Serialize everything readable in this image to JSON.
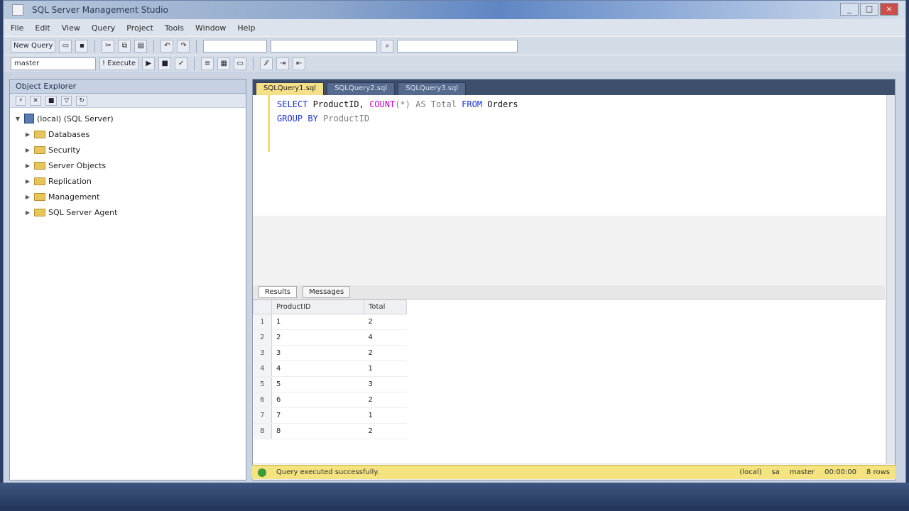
{
  "window": {
    "title": "SQL Server Management Studio",
    "controls": [
      "_",
      "□",
      "×"
    ]
  },
  "menu": [
    "File",
    "Edit",
    "View",
    "Query",
    "Project",
    "Tools",
    "Window",
    "Help"
  ],
  "toolbar": {
    "new_query_label": "New Query",
    "execute_label": "! Execute",
    "database_combo": "master"
  },
  "explorer": {
    "header": "Object Explorer",
    "nodes": [
      {
        "label": "(local) (SQL Server)",
        "level": 0,
        "icon": "server-icon"
      },
      {
        "label": "Databases",
        "level": 1,
        "icon": "folder-icon"
      },
      {
        "label": "Security",
        "level": 1,
        "icon": "folder-icon"
      },
      {
        "label": "Server Objects",
        "level": 1,
        "icon": "folder-icon"
      },
      {
        "label": "Replication",
        "level": 1,
        "icon": "folder-icon"
      },
      {
        "label": "Management",
        "level": 1,
        "icon": "folder-icon"
      },
      {
        "label": "SQL Server Agent",
        "level": 1,
        "icon": "folder-icon"
      }
    ]
  },
  "editor": {
    "tabs": [
      "SQLQuery1.sql",
      "SQLQuery2.sql",
      "SQLQuery3.sql"
    ],
    "code": {
      "line1": {
        "kw": "SELECT",
        "a": "ProductID,",
        "fn": "COUNT",
        "b": "(*) AS Total",
        "c": "FROM",
        "d": "Orders"
      },
      "line2": {
        "kw": "GROUP BY",
        "a": "ProductID"
      }
    }
  },
  "results": {
    "tabs": [
      "Results",
      "Messages"
    ],
    "columns": [
      "ProductID",
      "Total"
    ],
    "rows": [
      [
        "1",
        "2"
      ],
      [
        "2",
        "4"
      ],
      [
        "3",
        "2"
      ],
      [
        "4",
        "1"
      ],
      [
        "5",
        "3"
      ],
      [
        "6",
        "2"
      ],
      [
        "7",
        "1"
      ],
      [
        "8",
        "2"
      ]
    ]
  },
  "status": {
    "message": "Query executed successfully.",
    "server": "(local)",
    "user": "sa",
    "database": "master",
    "time": "00:00:00",
    "rows": "8 rows"
  }
}
